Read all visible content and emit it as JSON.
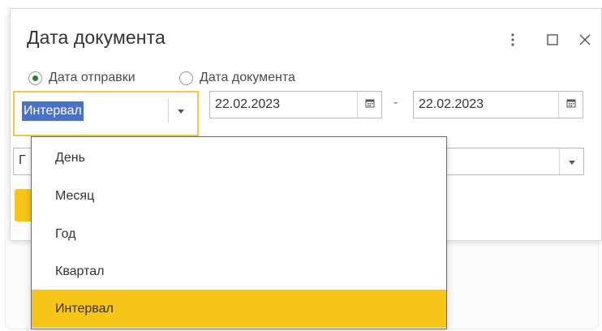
{
  "dialog": {
    "title": "Дата документа"
  },
  "radio": {
    "options": [
      {
        "label": "Дата отправки",
        "checked": true
      },
      {
        "label": "Дата документа",
        "checked": false
      }
    ]
  },
  "period_select": {
    "value": "Интервал"
  },
  "date_from": "22.02.2023",
  "date_to": "22.02.2023",
  "range_separator": "-",
  "second_row_left_text": "Г",
  "dropdown": {
    "items": [
      "День",
      "Месяц",
      "Год",
      "Квартал",
      "Интервал"
    ],
    "selected_index": 4
  },
  "colors": {
    "accent_yellow": "#f6c518",
    "focus_border": "#f2c94c",
    "selection_blue": "#4a72c4",
    "radio_green": "#2e7d32"
  },
  "icons": [
    "more-vertical-icon",
    "maximize-icon",
    "close-icon",
    "chevron-down-icon",
    "calendar-icon"
  ]
}
